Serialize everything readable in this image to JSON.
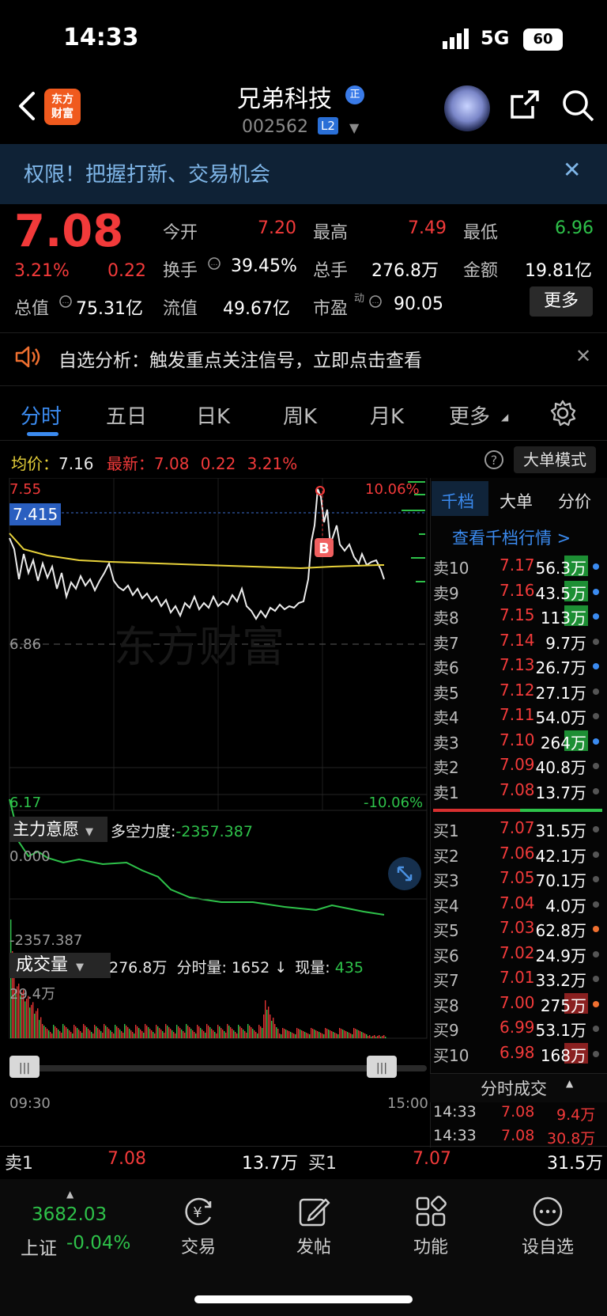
{
  "status_bar": {
    "time": "14:33",
    "network": "5G",
    "battery": "60"
  },
  "header": {
    "logo_text": "东方\n财富",
    "name": "兄弟科技",
    "name_badge": "正",
    "code": "002562",
    "level_badge": "L2"
  },
  "banner": {
    "text": "权限！把握打新、交易机会"
  },
  "quote": {
    "price": "7.08",
    "change_pct": "3.21%",
    "change": "0.22",
    "open_label": "今开",
    "open": "7.20",
    "high_label": "最高",
    "high": "7.49",
    "low_label": "最低",
    "low": "6.96",
    "turnover_label": "换手",
    "turnover": "39.45%",
    "volume_label": "总手",
    "volume": "276.8万",
    "amount_label": "金额",
    "amount": "19.81亿",
    "mktcap_label": "总值",
    "mktcap": "75.31亿",
    "float_label": "流值",
    "float_cap": "49.67亿",
    "pe_label": "市盈",
    "pe_sup": "动",
    "pe": "90.05",
    "more_label": "更多"
  },
  "notice": {
    "text": "自选分析：触发重点关注信号，立即点击查看"
  },
  "tabs": [
    {
      "label": "分时"
    },
    {
      "label": "五日"
    },
    {
      "label": "日K"
    },
    {
      "label": "周K"
    },
    {
      "label": "月K"
    },
    {
      "label": "更多"
    }
  ],
  "chart_info": {
    "avg_label": "均价：",
    "avg": "7.16",
    "last_label": "最新：",
    "last": "7.08",
    "chg": "0.22",
    "chg_pct": "3.21%",
    "big_order_label": "大单模式"
  },
  "chart_axes": {
    "y_top": "7.55",
    "y_top_pct": "10.06%",
    "y_mid": "6.86",
    "y_bottom": "6.17",
    "y_bottom_pct": "-10.06%",
    "crosshair": "7.415",
    "watermark": "东方财富",
    "marker": "B",
    "x_start": "09:30",
    "x_end": "15:00"
  },
  "main_force": {
    "title": "主力意愿",
    "label": "多空力度:",
    "value": "-2357.387",
    "y_top": "0.000",
    "y_bottom": "-2357.387"
  },
  "volume_panel": {
    "title": "成交量",
    "total": "276.8万",
    "tick_label": "分时量:",
    "tick": "1652",
    "arrow": "↓",
    "now_label": "现量:",
    "now": "435",
    "y_top": "29.4万"
  },
  "orderbook": {
    "tabs": [
      "千档",
      "大单",
      "分价"
    ],
    "link": "查看千档行情 >",
    "asks": [
      {
        "label": "卖10",
        "price": "7.17",
        "vol": "56.3万",
        "hl": "green",
        "dot": "blue"
      },
      {
        "label": "卖9",
        "price": "7.16",
        "vol": "43.5万",
        "hl": "green",
        "dot": "blue"
      },
      {
        "label": "卖8",
        "price": "7.15",
        "vol": "113万",
        "hl": "green",
        "dot": "blue"
      },
      {
        "label": "卖7",
        "price": "7.14",
        "vol": "9.7万",
        "hl": "",
        "dot": "gray"
      },
      {
        "label": "卖6",
        "price": "7.13",
        "vol": "26.7万",
        "hl": "",
        "dot": "blue"
      },
      {
        "label": "卖5",
        "price": "7.12",
        "vol": "27.1万",
        "hl": "",
        "dot": "gray"
      },
      {
        "label": "卖4",
        "price": "7.11",
        "vol": "54.0万",
        "hl": "",
        "dot": "gray"
      },
      {
        "label": "卖3",
        "price": "7.10",
        "vol": "264万",
        "hl": "green",
        "dot": "blue"
      },
      {
        "label": "卖2",
        "price": "7.09",
        "vol": "40.8万",
        "hl": "",
        "dot": "gray"
      },
      {
        "label": "卖1",
        "price": "7.08",
        "vol": "13.7万",
        "hl": "",
        "dot": "gray"
      }
    ],
    "bids": [
      {
        "label": "买1",
        "price": "7.07",
        "vol": "31.5万",
        "hl": "",
        "dot": "gray"
      },
      {
        "label": "买2",
        "price": "7.06",
        "vol": "42.1万",
        "hl": "",
        "dot": "gray"
      },
      {
        "label": "买3",
        "price": "7.05",
        "vol": "70.1万",
        "hl": "",
        "dot": "gray"
      },
      {
        "label": "买4",
        "price": "7.04",
        "vol": "4.0万",
        "hl": "",
        "dot": "gray"
      },
      {
        "label": "买5",
        "price": "7.03",
        "vol": "62.8万",
        "hl": "",
        "dot": "orange"
      },
      {
        "label": "买6",
        "price": "7.02",
        "vol": "24.9万",
        "hl": "",
        "dot": "gray"
      },
      {
        "label": "买7",
        "price": "7.01",
        "vol": "33.2万",
        "hl": "",
        "dot": "gray"
      },
      {
        "label": "买8",
        "price": "7.00",
        "vol": "275万",
        "hl": "red",
        "dot": "orange"
      },
      {
        "label": "买9",
        "price": "6.99",
        "vol": "53.1万",
        "hl": "",
        "dot": "gray"
      },
      {
        "label": "买10",
        "price": "6.98",
        "vol": "168万",
        "hl": "red",
        "dot": "gray"
      }
    ],
    "trades_title": "分时成交",
    "trades": [
      {
        "time": "14:33",
        "price": "7.08",
        "vol": "9.4万"
      },
      {
        "time": "14:33",
        "price": "7.08",
        "vol": "30.8万"
      }
    ]
  },
  "bottom_quote": {
    "ask_label": "卖1",
    "ask_price": "7.08",
    "ask_vol": "13.7万",
    "bid_label": "买1",
    "bid_price": "7.07",
    "bid_vol": "31.5万"
  },
  "bottom_nav": {
    "index_value": "3682.03",
    "index_name": "上证",
    "index_chg": "-0.04%",
    "items": [
      {
        "label": "交易"
      },
      {
        "label": "发帖"
      },
      {
        "label": "功能"
      },
      {
        "label": "设自选"
      }
    ]
  },
  "colors": {
    "up": "#f23a3a",
    "down": "#2ec24a",
    "avg_line": "#e8d23a",
    "accent": "#3b8bf0"
  }
}
